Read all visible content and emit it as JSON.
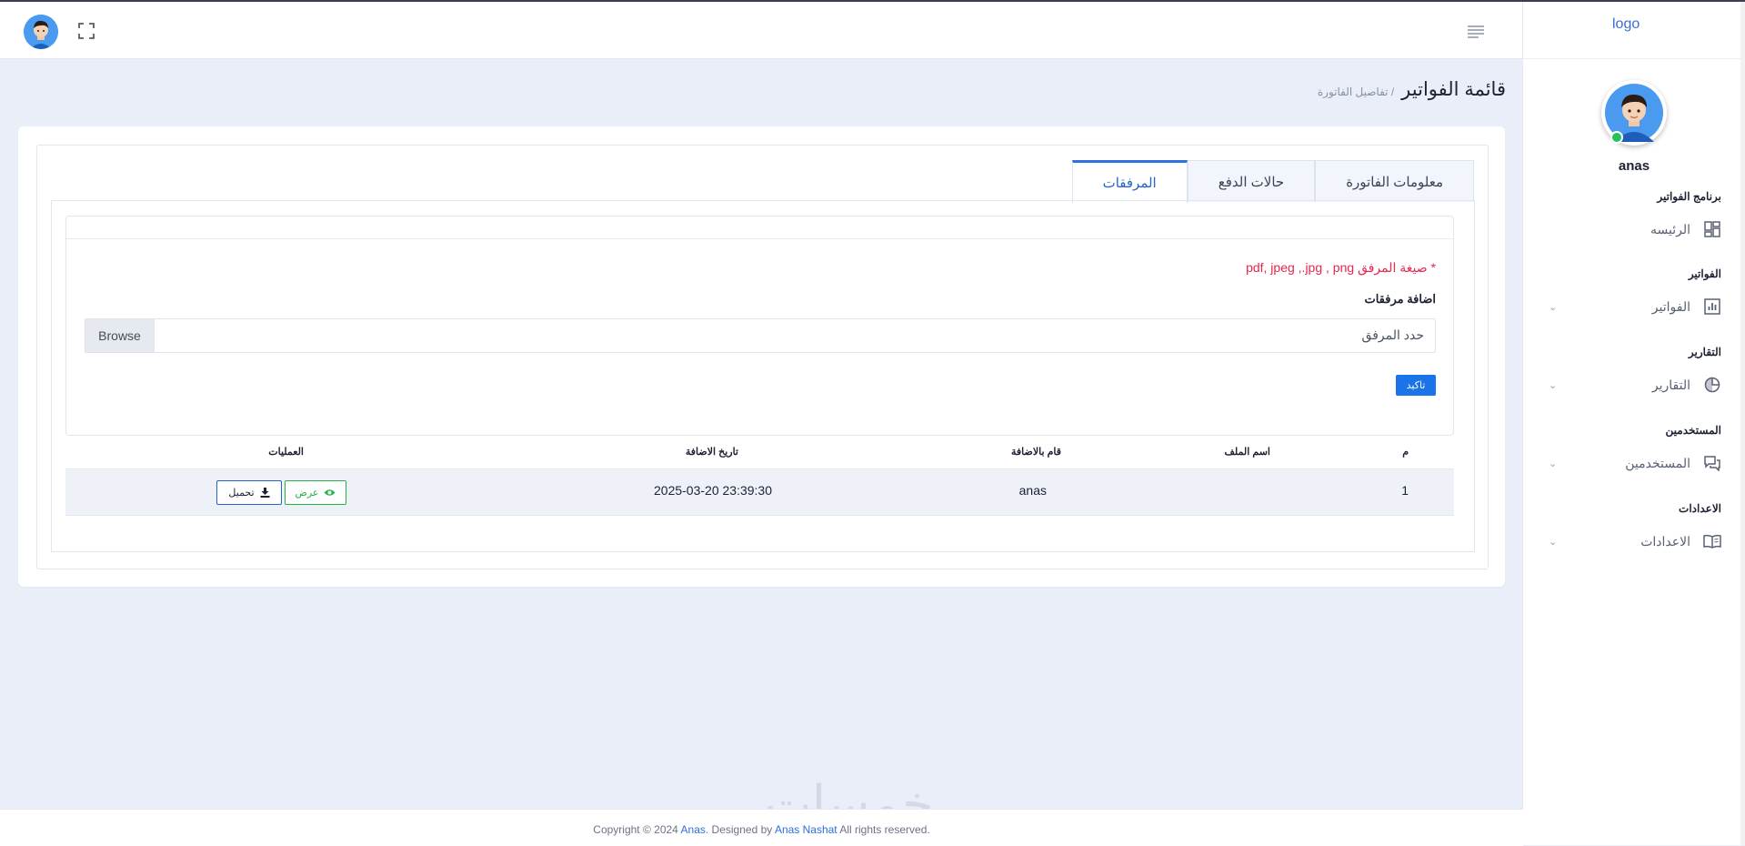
{
  "sidebar": {
    "logo_alt": "logo",
    "username": "anas",
    "sections": [
      {
        "title": "برنامج الفواتير",
        "item": {
          "label": "الرئيسه",
          "icon": "dashboard-icon",
          "has_chevron": false
        }
      },
      {
        "title": "الفواتير",
        "item": {
          "label": "الفواتير",
          "icon": "bar-chart-icon",
          "has_chevron": true
        }
      },
      {
        "title": "التقارير",
        "item": {
          "label": "التقارير",
          "icon": "pie-chart-icon",
          "has_chevron": true
        }
      },
      {
        "title": "المستخدمين",
        "item": {
          "label": "المستخدمين",
          "icon": "chat-icon",
          "has_chevron": true
        }
      },
      {
        "title": "الاعدادات",
        "item": {
          "label": "الاعدادات",
          "icon": "book-icon",
          "has_chevron": true
        }
      }
    ]
  },
  "header": {
    "menu_icon": "hamburger-icon",
    "expand_icon": "fullscreen-icon",
    "avatar_icon": "avatar"
  },
  "page": {
    "title": "قائمة الفواتير",
    "breadcrumb": "/ تفاصيل الفاتورة"
  },
  "tabs": [
    {
      "label": "معلومات الفاتورة",
      "active": false
    },
    {
      "label": "حالات الدفع",
      "active": false
    },
    {
      "label": "المرفقات",
      "active": true
    }
  ],
  "attachments": {
    "format_hint": "* صيغة المرفق pdf, jpeg ,.jpg , png",
    "add_label": "اضافة مرفقات",
    "file_placeholder": "حدد المرفق",
    "browse_label": "Browse",
    "confirm_label": "تاكيد"
  },
  "table": {
    "headers": [
      "م",
      "اسم الملف",
      "قام بالاضافة",
      "تاريخ الاضافة",
      "العمليات"
    ],
    "rows": [
      {
        "index": "1",
        "file_name": "",
        "added_by": "anas",
        "date_added": "2025-03-20 23:39:30",
        "view_label": "عرض",
        "download_label": "تحميل"
      }
    ]
  },
  "footer": {
    "prefix": "Copyright © 2024 ",
    "brand": "Anas",
    "middle": ". Designed by ",
    "designer": "Anas Nashat",
    "suffix": " All rights reserved."
  },
  "watermark": "خمسات",
  "colors": {
    "accent": "#2f6fde",
    "danger": "#e8264e",
    "success": "#25b046",
    "background": "#eaeef9"
  }
}
